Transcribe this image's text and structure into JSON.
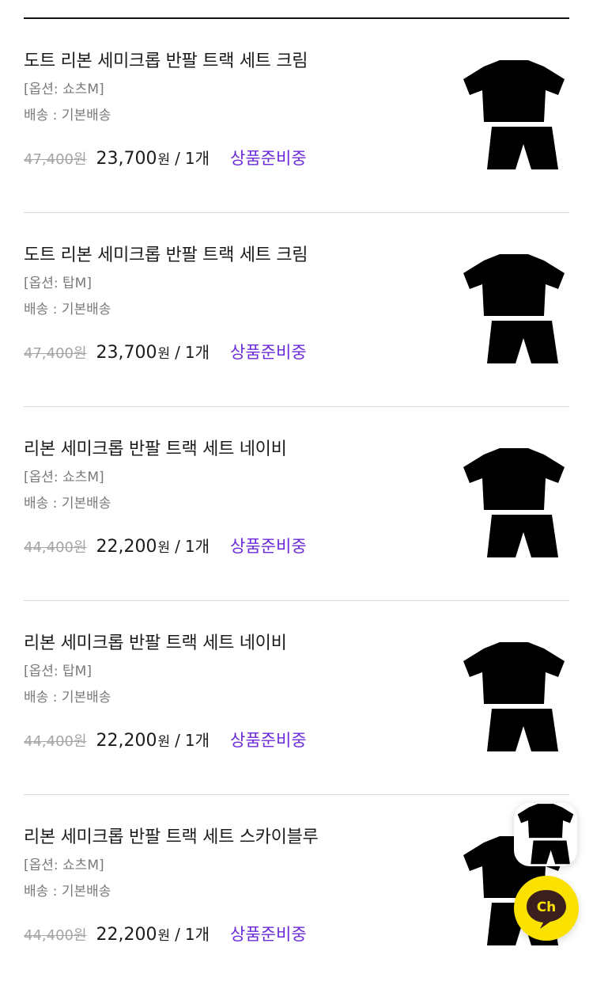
{
  "orders": [
    {
      "name": "도트 리본 세미크롭 반팔 트랙 세트 크림",
      "option": "[옵션: 쇼츠M]",
      "shipping": "배송 : 기본배송",
      "original_price": "47,400원",
      "sale_price": "23,700",
      "currency": "원",
      "separator": "/",
      "quantity": "1개",
      "status": "상품준비중",
      "thumbnail": "cream-track-set-image"
    },
    {
      "name": "도트 리본 세미크롭 반팔 트랙 세트 크림",
      "option": "[옵션: 탑M]",
      "shipping": "배송 : 기본배송",
      "original_price": "47,400원",
      "sale_price": "23,700",
      "currency": "원",
      "separator": "/",
      "quantity": "1개",
      "status": "상품준비중",
      "thumbnail": "cream-track-set-image"
    },
    {
      "name": "리본 세미크롭 반팔 트랙 세트 네이비",
      "option": "[옵션: 쇼츠M]",
      "shipping": "배송 : 기본배송",
      "original_price": "44,400원",
      "sale_price": "22,200",
      "currency": "원",
      "separator": "/",
      "quantity": "1개",
      "status": "상품준비중",
      "thumbnail": "navy-track-set-image"
    },
    {
      "name": "리본 세미크롭 반팔 트랙 세트 네이비",
      "option": "[옵션: 탑M]",
      "shipping": "배송 : 기본배송",
      "original_price": "44,400원",
      "sale_price": "22,200",
      "currency": "원",
      "separator": "/",
      "quantity": "1개",
      "status": "상품준비중",
      "thumbnail": "navy-track-set-image"
    },
    {
      "name": "리본 세미크롭 반팔 트랙 세트 스카이블루",
      "option": "[옵션: 쇼츠M]",
      "shipping": "배송 : 기본배송",
      "original_price": "44,400원",
      "sale_price": "22,200",
      "currency": "원",
      "separator": "/",
      "quantity": "1개",
      "status": "상품준비중",
      "thumbnail": "skyblue-track-set-image"
    }
  ],
  "chat_button": {
    "label": "Ch",
    "icon": "chat-bubble-icon"
  },
  "colors": {
    "status": "#6c2bd9",
    "cream": "#f4efe1",
    "navy": "#1b2240",
    "skyblue": "#cfe8f4",
    "chat_yellow": "#fae100",
    "divider": "#d9d9d9"
  }
}
